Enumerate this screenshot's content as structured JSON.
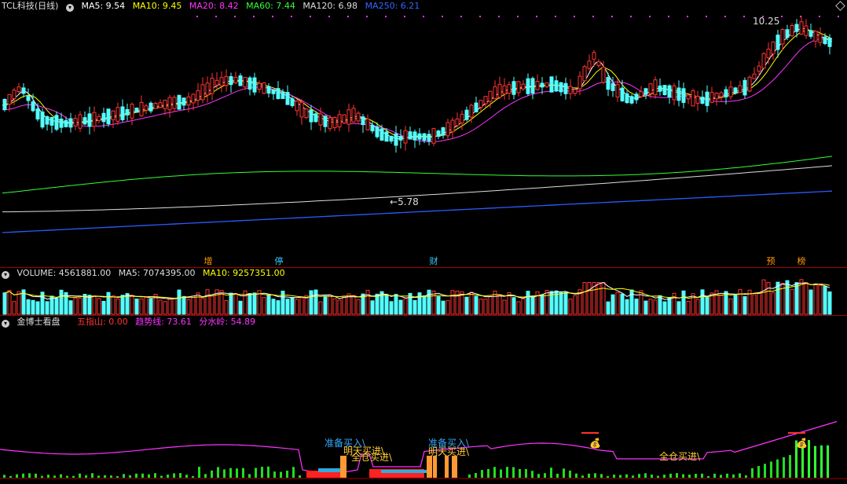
{
  "main": {
    "title": "TCL科技(日线)",
    "ma": [
      {
        "label": "MA5: 9.54",
        "color": "#ffffff"
      },
      {
        "label": "MA10: 9.45",
        "color": "#ffff00"
      },
      {
        "label": "MA20: 8.42",
        "color": "#ff00ff"
      },
      {
        "label": "MA60: 7.44",
        "color": "#00ff00"
      },
      {
        "label": "MA120: 6.98",
        "color": "#dddddd"
      },
      {
        "label": "MA250: 6.21",
        "color": "#2a5cff"
      }
    ],
    "high_label": "10.25",
    "low_label": "5.78",
    "badges": [
      {
        "text": "增",
        "color": "#ff9900"
      },
      {
        "text": "停",
        "color": "#33ccff"
      },
      {
        "text": "财",
        "color": "#33ccff"
      },
      {
        "text": "预",
        "color": "#ff9900"
      },
      {
        "text": "榜",
        "color": "#ff9900"
      }
    ]
  },
  "volume": {
    "label": "VOLUME: 4561881.00",
    "ma5": "MA5: 7074395.00",
    "ma10": "MA10: 9257351.00"
  },
  "indicator": {
    "title": "金博士看盘",
    "a": "五指山: 0.00",
    "b": "趋势线: 73.61",
    "c": "分水岭: 54.89",
    "ann_prepare": "准备买入\\",
    "ann_tomorrow": "明天买进\\",
    "ann_full": "全仓买进\\",
    "ann_prepare2": "准备买入\\",
    "ann_tomorrow2": "明天买进\\",
    "ann_full2": "全仓买进\\"
  },
  "colors": {
    "up": "#ff3333",
    "down": "#54ffff",
    "grid": "#a00000",
    "purple": "#ff00ff"
  }
}
